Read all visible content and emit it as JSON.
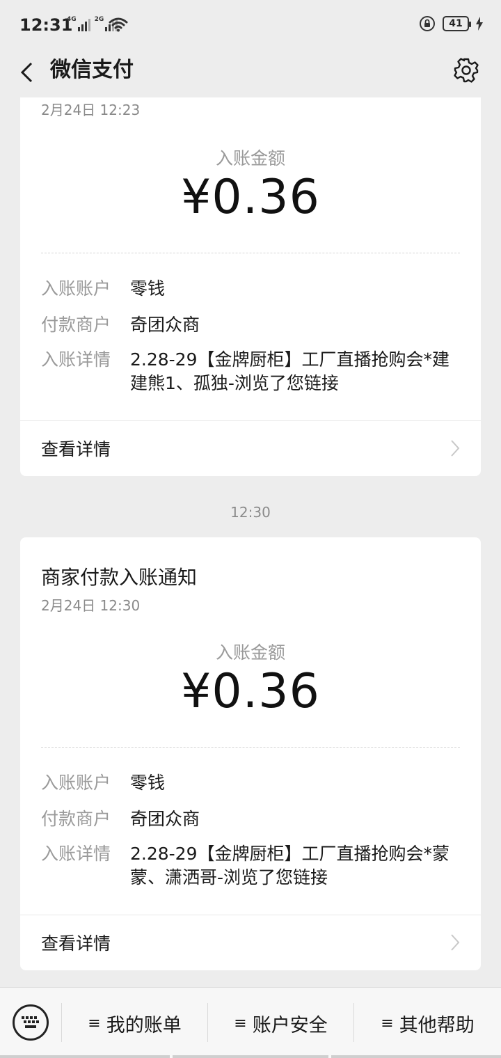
{
  "status": {
    "time": "12:31",
    "net1": "4G",
    "net2": "2G",
    "battery": "41"
  },
  "nav": {
    "title": "微信支付"
  },
  "cards": [
    {
      "date": "2月24日 12:23",
      "amount_label": "入账金额",
      "amount": "¥0.36",
      "rows": [
        {
          "label": "入账账户",
          "value": "零钱"
        },
        {
          "label": "付款商户",
          "value": "奇团众商"
        },
        {
          "label": "入账详情",
          "value": "2.28-29【金牌厨柜】工厂直播抢购会*建建熊1、孤独-浏览了您链接"
        }
      ],
      "detail": "查看详情"
    },
    {
      "title": "商家付款入账通知",
      "date": "2月24日 12:30",
      "amount_label": "入账金额",
      "amount": "¥0.36",
      "rows": [
        {
          "label": "入账账户",
          "value": "零钱"
        },
        {
          "label": "付款商户",
          "value": "奇团众商"
        },
        {
          "label": "入账详情",
          "value": "2.28-29【金牌厨柜】工厂直播抢购会*蒙蒙、潇洒哥-浏览了您链接"
        }
      ],
      "detail": "查看详情"
    }
  ],
  "timestamp": "12:30",
  "menu": [
    "我的账单",
    "账户安全",
    "其他帮助"
  ],
  "menu_prefix": "≡",
  "colors": {
    "background": "#ededed",
    "card": "#ffffff",
    "muted": "#9a9a9a"
  }
}
